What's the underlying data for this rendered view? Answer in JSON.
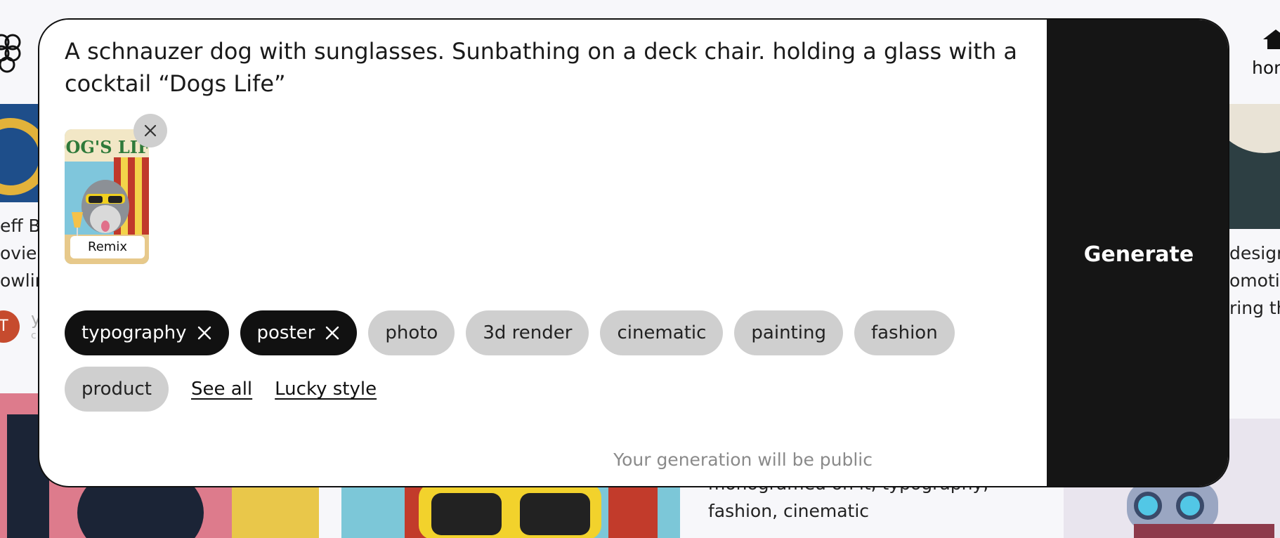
{
  "prompt": {
    "text": "A schnauzer dog with sunglasses. Sunbathing on a deck chair. holding a glass with a cocktail “Dogs Life”"
  },
  "remix": {
    "label": "Remix",
    "thumbnail_title": "DOG'S LIFE"
  },
  "styles": {
    "selected": [
      {
        "label": "typography"
      },
      {
        "label": "poster"
      }
    ],
    "options": [
      {
        "label": "photo"
      },
      {
        "label": "3d render"
      },
      {
        "label": "cinematic"
      },
      {
        "label": "painting"
      },
      {
        "label": "fashion"
      },
      {
        "label": "product"
      }
    ],
    "see_all": "See all",
    "lucky": "Lucky style"
  },
  "public_note": "Your generation will be public",
  "generate_label": "Generate",
  "background": {
    "nav_home": "hon",
    "left_lines": [
      "eff Br",
      "ovie",
      "owlin"
    ],
    "avatar_letter": "T",
    "meta_line1": "y",
    "meta_line2": "c",
    "right_lines": [
      "desigr",
      "omoti",
      "ring th"
    ],
    "center_lines": [
      "monogramed on it, typography,",
      "fashion, cinematic"
    ]
  },
  "colors": {
    "chip_selected": "#111111",
    "chip_default": "#cfcfcf",
    "generate_bg": "#151515"
  }
}
